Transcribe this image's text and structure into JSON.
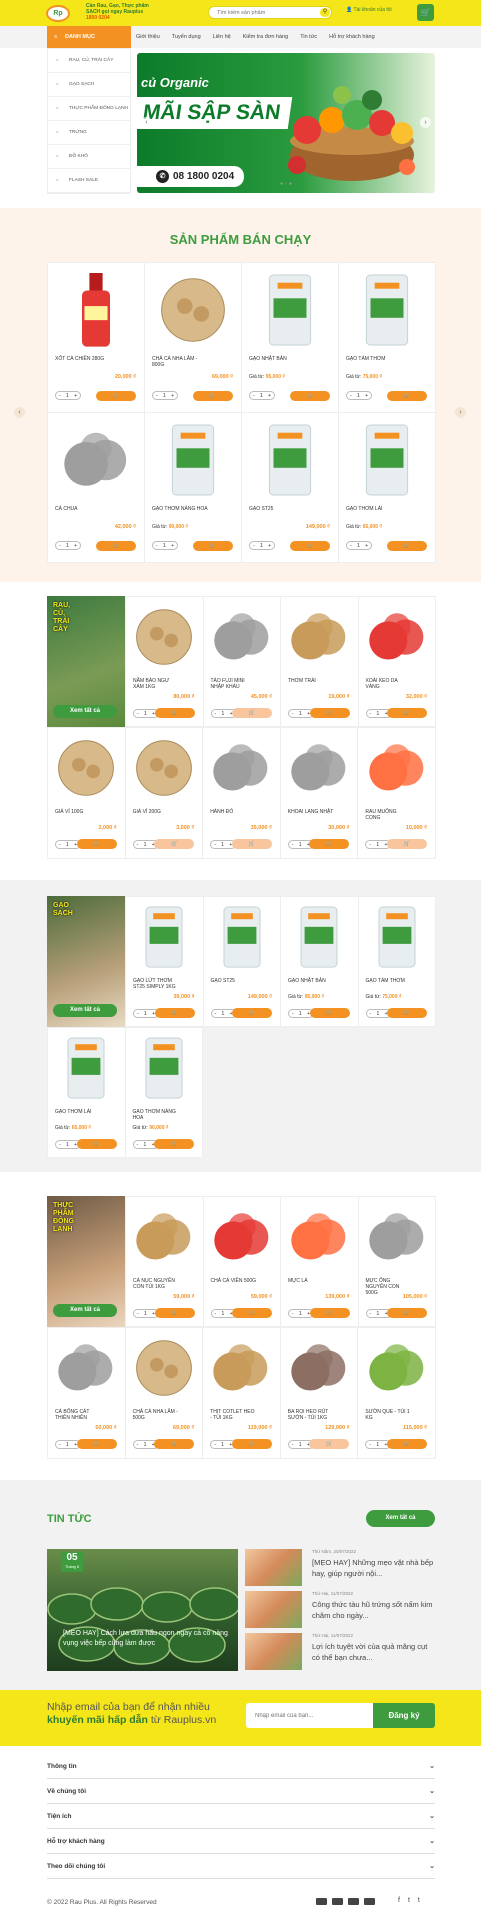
{
  "header": {
    "slogan_line1": "Cần Rau, Gạo, Thực phẩm",
    "slogan_line2": "SẠCH gọi ngay Rauplus",
    "slogan_phone": "1800 0204",
    "search_placeholder": "Tìm kiếm sản phẩm",
    "account": "Tài khoản của tôi",
    "logo_text": "Rp"
  },
  "nav": {
    "menu_label": "DANH MỤC",
    "links": [
      "Giới thiệu",
      "Tuyển dụng",
      "Liên hệ",
      "Kiểm tra đơn hàng",
      "Tin tức",
      "Hỗ trợ khách hàng"
    ]
  },
  "sidebar": [
    "RAU, CỦ, TRÁI CÂY",
    "GẠO SẠCH",
    "THỰC PHẨM ĐÔNG LẠNH",
    "TRỨNG",
    "ĐỒ KHÔ",
    "FLASH SALE"
  ],
  "banner": {
    "line1": "củ Organic",
    "line2": "MÃI SẬP SÀN",
    "phone": "08 1800 0204"
  },
  "bestseller": {
    "title": "SẢN PHẨM BÁN CHẠY",
    "items": [
      {
        "name": "XỐT CÀ CHIÊN 280G",
        "price": "20,000 ₫"
      },
      {
        "name": "CHẢ CÁ NHA LÂM - 800G",
        "price": "69,000 ₫"
      },
      {
        "name": "GẠO NHẬT BẢN",
        "from": "95,000 ₫"
      },
      {
        "name": "GẠO TÁM THƠM",
        "from": "75,000 ₫"
      },
      {
        "name": "CÀ CHUA",
        "price": "42,000 ₫"
      },
      {
        "name": "GẠO THƠM NÀNG HOA",
        "from": "90,000 ₫"
      },
      {
        "name": "GẠO ST25",
        "price": "149,000 ₫"
      },
      {
        "name": "GẠO THƠM LÀI",
        "from": "65,000 ₫"
      }
    ]
  },
  "from_label": "Giá từ:",
  "qty_value": "1",
  "view_all": "Xem tất cả",
  "cat1": {
    "title": "RAU, CỦ, TRÁI CÂY",
    "items": [
      {
        "name": "NẤM BÀO NGƯ XÁM 1KG",
        "price": "80,000 ₫"
      },
      {
        "name": "TÁO FUJI MINI NHẬP KHẨU",
        "price": "45,000 ₫"
      },
      {
        "name": "THƠM TRÁI",
        "price": "19,000 ₫"
      },
      {
        "name": "XOÀI KEO DA VÀNG",
        "price": "32,000 ₫"
      },
      {
        "name": "GIÁ VỈ 100G",
        "price": "2,000 ₫"
      },
      {
        "name": "GIÁ VỈ 200G",
        "price": "3,000 ₫"
      },
      {
        "name": "HÀNH ĐỎ",
        "price": "35,000 ₫"
      },
      {
        "name": "KHOAI LANG NHẬT",
        "price": "30,000 ₫"
      },
      {
        "name": "RAU MUỐNG CỌNG",
        "price": "10,000 ₫"
      }
    ]
  },
  "cat2": {
    "title": "GẠO SẠCH",
    "items": [
      {
        "name": "GẠO LỨT THƠM ST25 SIMPLY 1KG",
        "price": "39,000 ₫"
      },
      {
        "name": "GẠO ST25",
        "price": "149,000 ₫"
      },
      {
        "name": "GẠO NHẬT BẢN",
        "from": "95,000 ₫"
      },
      {
        "name": "GẠO TÁM THƠM",
        "from": "75,000 ₫"
      },
      {
        "name": "GẠO THƠM LÀI",
        "from": "65,000 ₫"
      },
      {
        "name": "GẠO THƠM NÀNG HOA",
        "from": "90,000 ₫"
      }
    ]
  },
  "cat3": {
    "title": "THỰC PHẨM ĐÔNG LẠNH",
    "items": [
      {
        "name": "CÁ NỤC NGUYÊN CON TÚI 1KG",
        "price": "59,000 ₫"
      },
      {
        "name": "CHẢ CÁ VIÊN 500G",
        "price": "59,000 ₫"
      },
      {
        "name": "MỰC LÁ",
        "price": "139,000 ₫"
      },
      {
        "name": "MỰC ỐNG NGUYÊN CON 500G",
        "price": "105,000 ₫"
      },
      {
        "name": "CÁ BỐNG CÁT THIÊN NHIÊN",
        "price": "50,000 ₫"
      },
      {
        "name": "CHẢ CÁ NHA LÂM - 500G",
        "price": "69,000 ₫"
      },
      {
        "name": "THỊT COTLET HEO - TÚI 1KG",
        "price": "119,000 ₫"
      },
      {
        "name": "BA RỌI HEO RÚT SƯỜN - TÚI 1KG",
        "price": "129,000 ₫"
      },
      {
        "name": "SƯỜN QUE - TÚI 1 KG",
        "price": "115,000 ₫"
      }
    ]
  },
  "news": {
    "title": "TIN TỨC",
    "view_all": "Xem tất cả",
    "main": {
      "day": "05",
      "month": "Tháng 8",
      "title": "[MẸO HAY] Cách lựa dưa hấu ngon ngay cả cô nàng vụng việc bếp cũng làm được"
    },
    "items": [
      {
        "date": "Thứ Năm, 20/07/2022",
        "title": "[MẸO HAY] Những mẹo vặt nhà bếp hay, giúp người nội..."
      },
      {
        "date": "Thứ Hai, 11/07/2022",
        "title": "Công thức tàu hũ trứng sốt nấm kim châm cho ngày..."
      },
      {
        "date": "Thứ Hai, 11/07/2022",
        "title": "Lợi ích tuyệt vời của quả măng cụt có thể bạn chưa..."
      }
    ]
  },
  "newsletter": {
    "pre": "Nhập email của bạn để nhận nhiều",
    "bold": "khuyến mãi hấp dẫn",
    "post": "từ Rauplus.vn",
    "placeholder": "Nhập email của bạn...",
    "button": "Đăng ký"
  },
  "footer": {
    "sections": [
      "Thông tin",
      "Về chúng tôi",
      "Tiện ích",
      "Hỗ trợ khách hàng",
      "Theo dõi chúng tôi"
    ],
    "copyright": "© 2022 Rau Plus. All Rights Reserved",
    "social": [
      "f",
      "t",
      "t"
    ]
  },
  "colors": {
    "green": "#3e9c3f",
    "orange": "#f39222",
    "yellow": "#f5e61a"
  }
}
